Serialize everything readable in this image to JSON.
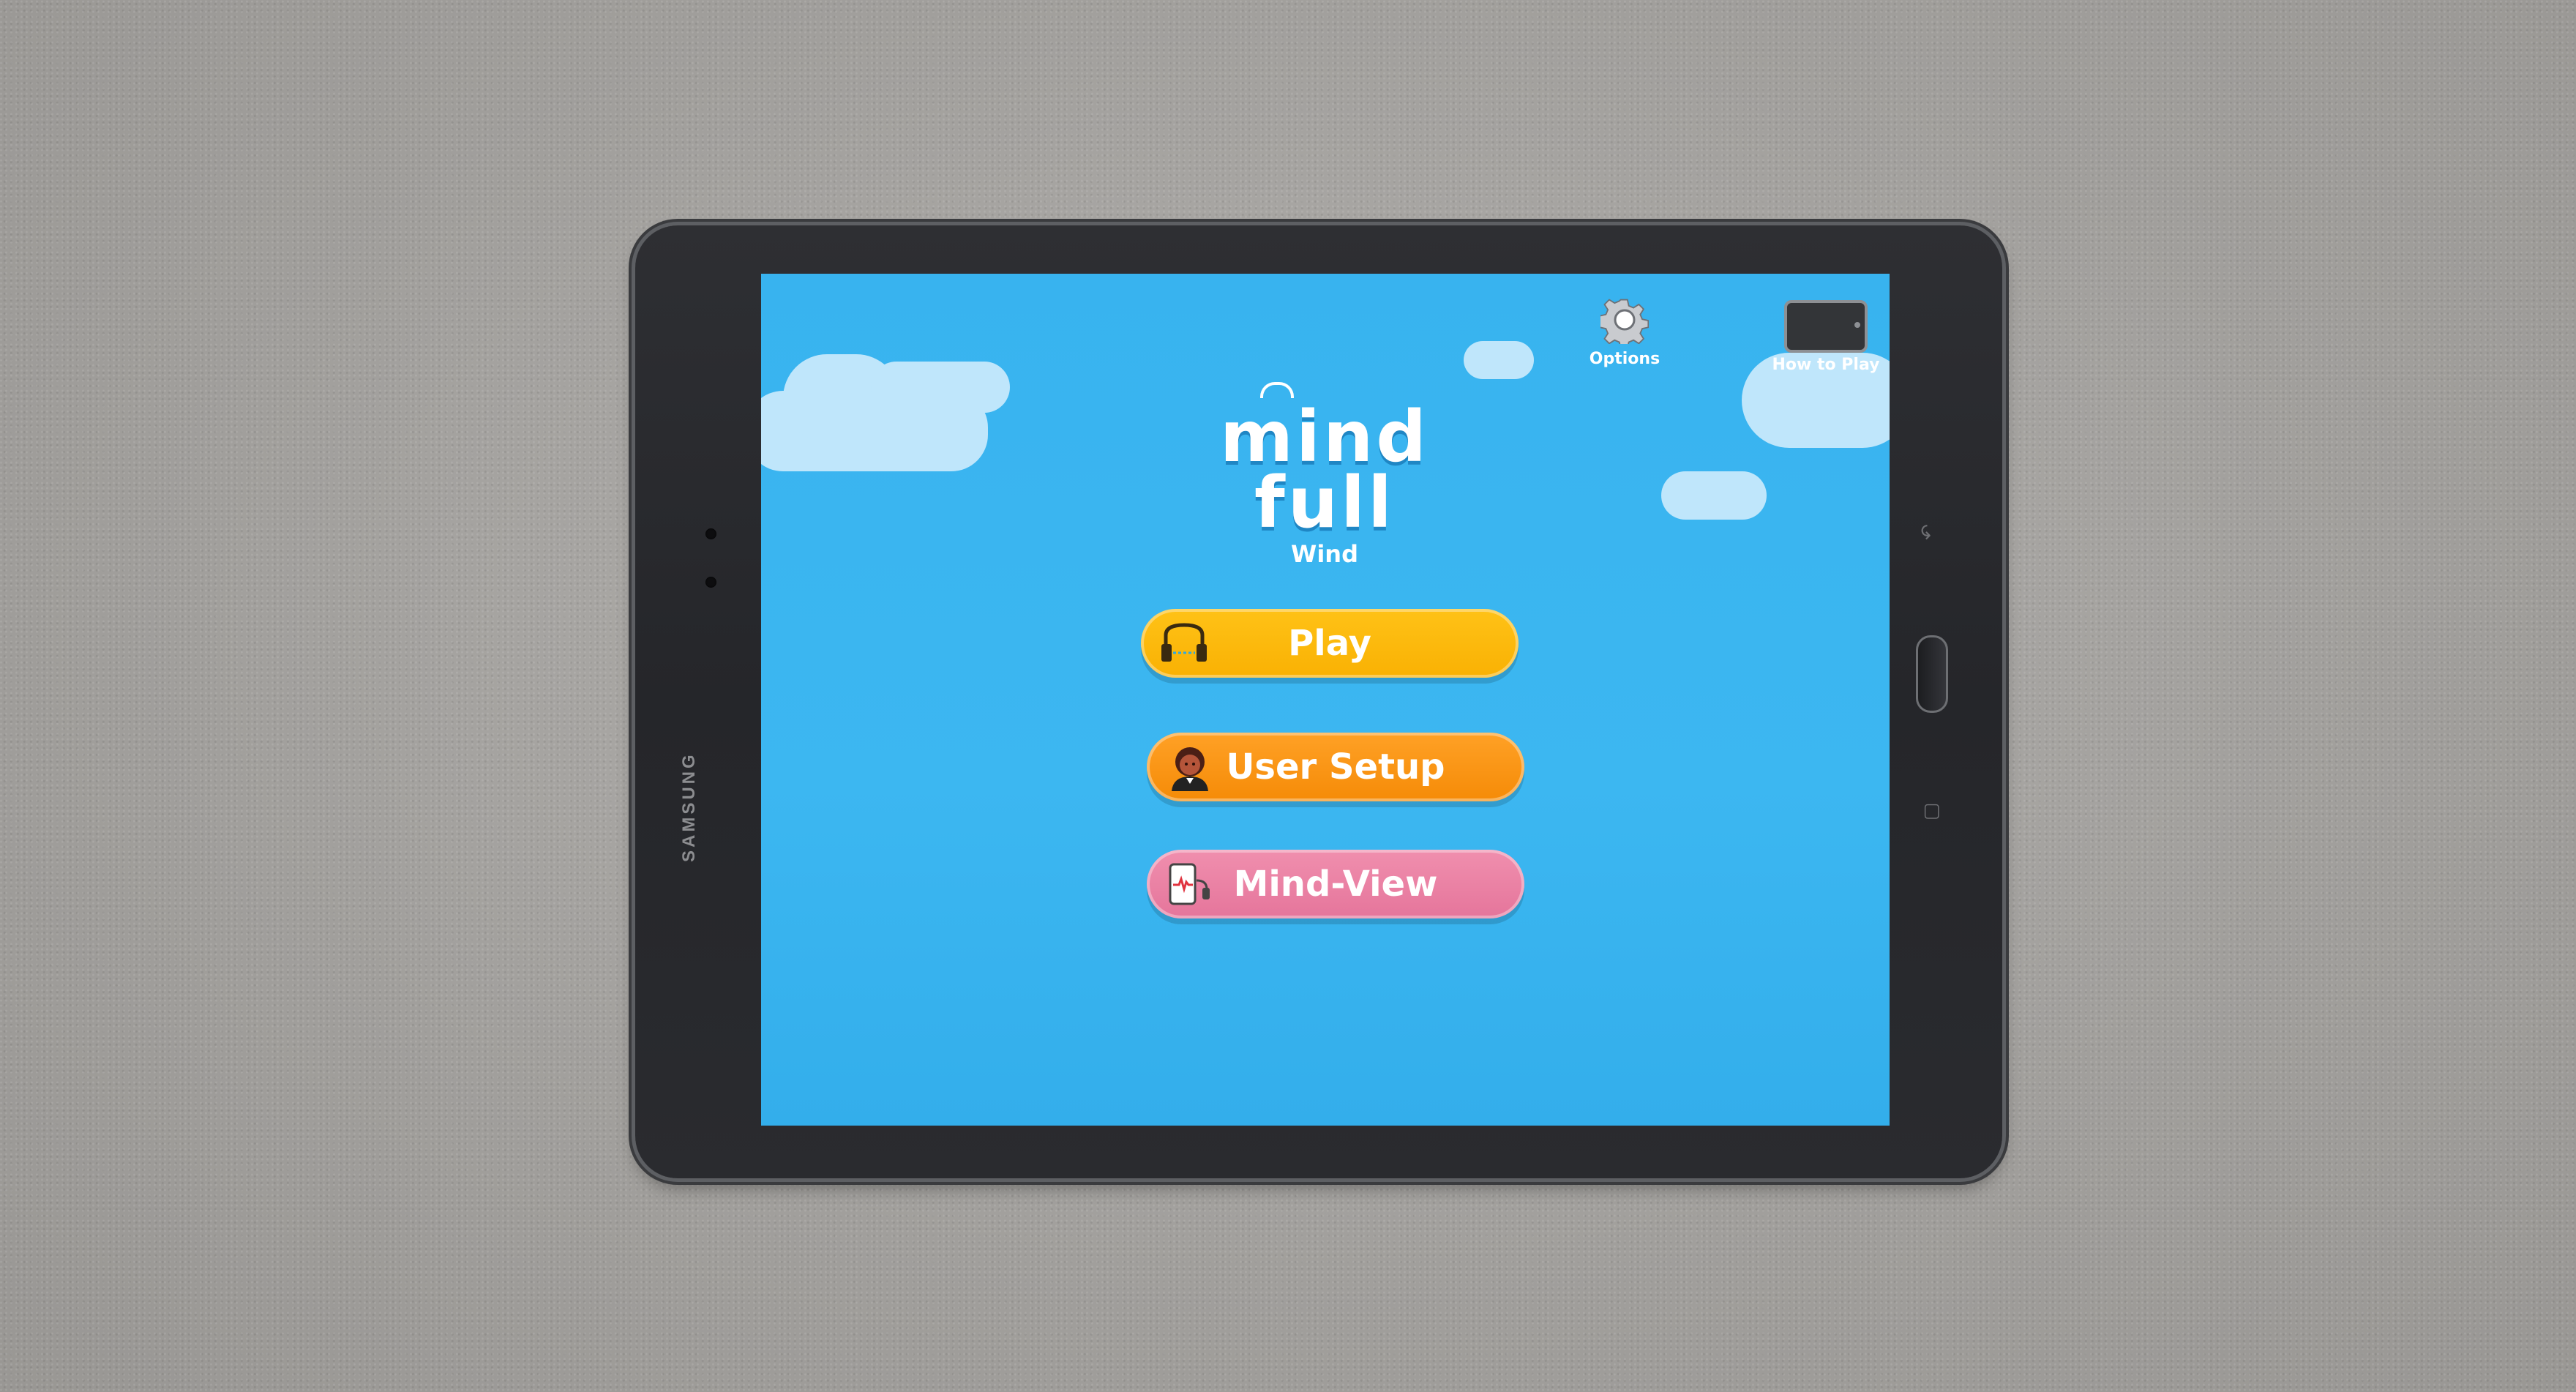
{
  "device": {
    "brand": "SAMSUNG"
  },
  "topbar": {
    "options_label": "Options",
    "how_to_play_label": "How to Play"
  },
  "logo": {
    "line1": "mind",
    "line2": "full",
    "subtitle": "Wind"
  },
  "menu": {
    "play_label": "Play",
    "user_setup_label": "User Setup",
    "mind_view_label": "Mind-View"
  },
  "icons": {
    "options": "gear-icon",
    "how_to_play": "tablet-icon",
    "play": "headphones-icon",
    "user_setup": "avatar-icon",
    "mind_view": "tablet-heartbeat-icon"
  },
  "colors": {
    "sky": "#38b3ef",
    "play": "#fbb40a",
    "user_setup": "#f8911a",
    "mind_view": "#ea80a3"
  }
}
